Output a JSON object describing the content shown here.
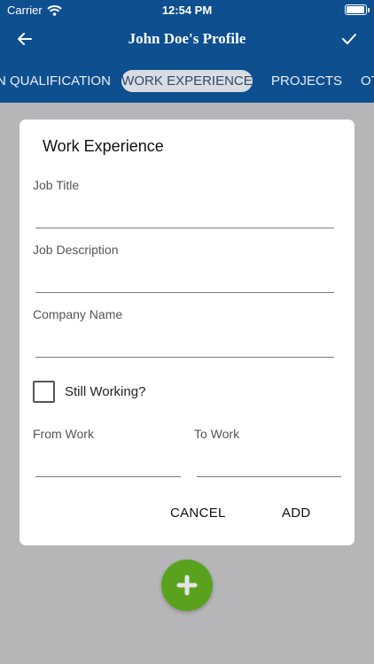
{
  "status": {
    "carrier": "Carrier",
    "time": "12:54 PM",
    "battery_level": 0.95
  },
  "header": {
    "title": "John Doe's Profile"
  },
  "tabs": [
    {
      "label": "N QUALIFICATION",
      "active": false
    },
    {
      "label": "WORK EXPERIENCE",
      "active": true
    },
    {
      "label": "PROJECTS",
      "active": false
    },
    {
      "label": "OT",
      "active": false
    }
  ],
  "dialog": {
    "title": "Work Experience",
    "job_title_label": "Job Title",
    "job_title_value": "",
    "job_description_label": "Job Description",
    "job_description_value": "",
    "company_name_label": "Company Name",
    "company_name_value": "",
    "still_working_label": "Still Working?",
    "still_working_checked": false,
    "from_work_label": "From Work",
    "from_work_value": "",
    "to_work_label": "To Work",
    "to_work_value": "",
    "cancel_label": "CANCEL",
    "add_label": "ADD"
  },
  "colors": {
    "brand": "#0e4f8f",
    "fab": "#5aa21e",
    "overlay": "#b6b6b9"
  },
  "icons": {
    "back": "arrow-left-icon",
    "confirm": "checkmark-icon",
    "fab": "plus-icon",
    "wifi": "wifi-icon",
    "battery": "battery-icon"
  }
}
